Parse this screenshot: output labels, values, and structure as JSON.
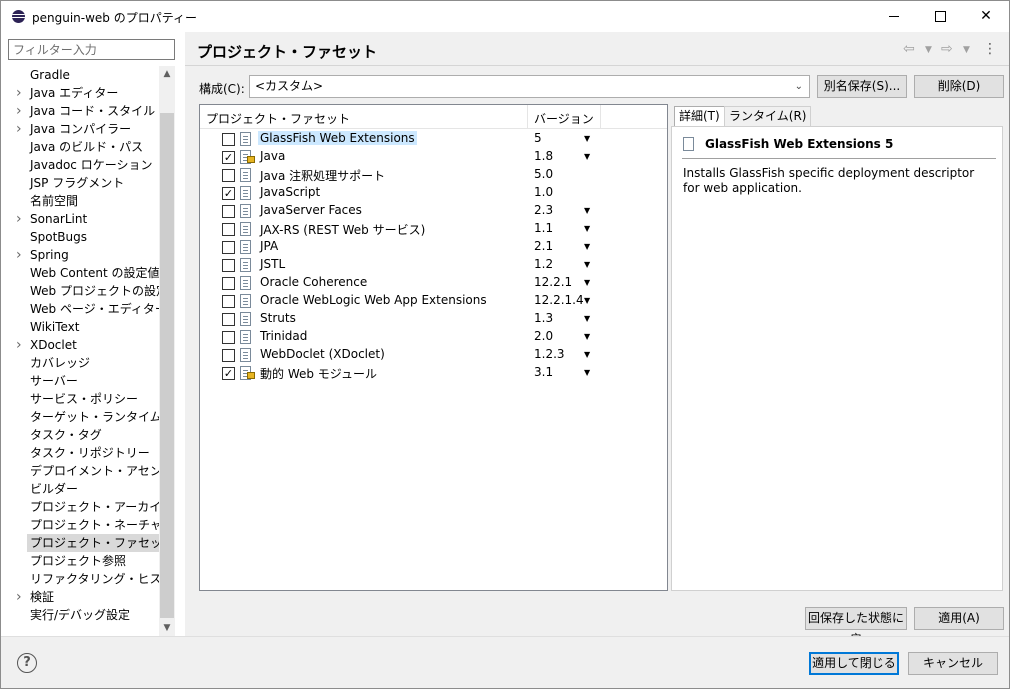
{
  "window": {
    "title": "penguin-web のプロパティー"
  },
  "sidebar": {
    "filter_placeholder": "フィルター入力",
    "items": [
      {
        "label": "Gradle",
        "expandable": false
      },
      {
        "label": "Java エディター",
        "expandable": true
      },
      {
        "label": "Java コード・スタイル",
        "expandable": true
      },
      {
        "label": "Java コンパイラー",
        "expandable": true
      },
      {
        "label": "Java のビルド・パス",
        "expandable": false
      },
      {
        "label": "Javadoc ロケーション",
        "expandable": false
      },
      {
        "label": "JSP フラグメント",
        "expandable": false
      },
      {
        "label": "名前空間",
        "expandable": false
      },
      {
        "label": "SonarLint",
        "expandable": true
      },
      {
        "label": "SpotBugs",
        "expandable": false
      },
      {
        "label": "Spring",
        "expandable": true
      },
      {
        "label": "Web Content の設定値",
        "expandable": false
      },
      {
        "label": "Web プロジェクトの設定",
        "expandable": false
      },
      {
        "label": "Web ページ・エディター",
        "expandable": false
      },
      {
        "label": "WikiText",
        "expandable": false
      },
      {
        "label": "XDoclet",
        "expandable": true
      },
      {
        "label": "カバレッジ",
        "expandable": false
      },
      {
        "label": "サーバー",
        "expandable": false
      },
      {
        "label": "サービス・ポリシー",
        "expandable": false
      },
      {
        "label": "ターゲット・ランタイム",
        "expandable": false
      },
      {
        "label": "タスク・タグ",
        "expandable": false
      },
      {
        "label": "タスク・リポジトリー",
        "expandable": false
      },
      {
        "label": "デプロイメント・アセンブリー",
        "expandable": false
      },
      {
        "label": "ビルダー",
        "expandable": false
      },
      {
        "label": "プロジェクト・アーカイブ",
        "expandable": false
      },
      {
        "label": "プロジェクト・ネーチャー",
        "expandable": false
      },
      {
        "label": "プロジェクト・ファセット",
        "expandable": false,
        "selected": true
      },
      {
        "label": "プロジェクト参照",
        "expandable": false
      },
      {
        "label": "リファクタリング・ヒストリー",
        "expandable": false
      },
      {
        "label": "検証",
        "expandable": true
      },
      {
        "label": "実行/デバッグ設定",
        "expandable": false
      }
    ]
  },
  "main": {
    "title": "プロジェクト・ファセット",
    "config_label": "構成(C):",
    "config_value": "<カスタム>",
    "save_as_button": "別名保存(S)...",
    "delete_button": "削除(D)",
    "facets_header": {
      "facet": "プロジェクト・ファセット",
      "version": "バージョン"
    },
    "facets": [
      {
        "name": "GlassFish Web Extensions",
        "version": "5",
        "checked": false,
        "locked": false,
        "dropdown": true,
        "highlight": true
      },
      {
        "name": "Java",
        "version": "1.8",
        "checked": true,
        "locked": true,
        "dropdown": true
      },
      {
        "name": "Java 注釈処理サポート",
        "version": "5.0",
        "checked": false,
        "locked": false,
        "dropdown": false
      },
      {
        "name": "JavaScript",
        "version": "1.0",
        "checked": true,
        "locked": false,
        "dropdown": false
      },
      {
        "name": "JavaServer Faces",
        "version": "2.3",
        "checked": false,
        "locked": false,
        "dropdown": true
      },
      {
        "name": "JAX-RS (REST Web サービス)",
        "version": "1.1",
        "checked": false,
        "locked": false,
        "dropdown": true
      },
      {
        "name": "JPA",
        "version": "2.1",
        "checked": false,
        "locked": false,
        "dropdown": true
      },
      {
        "name": "JSTL",
        "version": "1.2",
        "checked": false,
        "locked": false,
        "dropdown": true
      },
      {
        "name": "Oracle Coherence",
        "version": "12.2.1",
        "checked": false,
        "locked": false,
        "dropdown": true
      },
      {
        "name": "Oracle WebLogic Web App Extensions",
        "version": "12.2.1.4",
        "checked": false,
        "locked": false,
        "dropdown": true
      },
      {
        "name": "Struts",
        "version": "1.3",
        "checked": false,
        "locked": false,
        "dropdown": true
      },
      {
        "name": "Trinidad",
        "version": "2.0",
        "checked": false,
        "locked": false,
        "dropdown": true
      },
      {
        "name": "WebDoclet (XDoclet)",
        "version": "1.2.3",
        "checked": false,
        "locked": false,
        "dropdown": true
      },
      {
        "name": "動的 Web モジュール",
        "version": "3.1",
        "checked": true,
        "locked": true,
        "dropdown": true
      }
    ],
    "detail": {
      "tab_details": "詳細(T)",
      "tab_runtime": "ランタイム(R)",
      "title": "GlassFish Web Extensions 5",
      "description": "Installs GlassFish specific deployment descriptor for web application."
    },
    "restore_button": "回保存した状態に戻",
    "apply_button": "適用(A)"
  },
  "footer": {
    "apply_close_button": "適用して閉じる",
    "cancel_button": "キャンセル"
  }
}
